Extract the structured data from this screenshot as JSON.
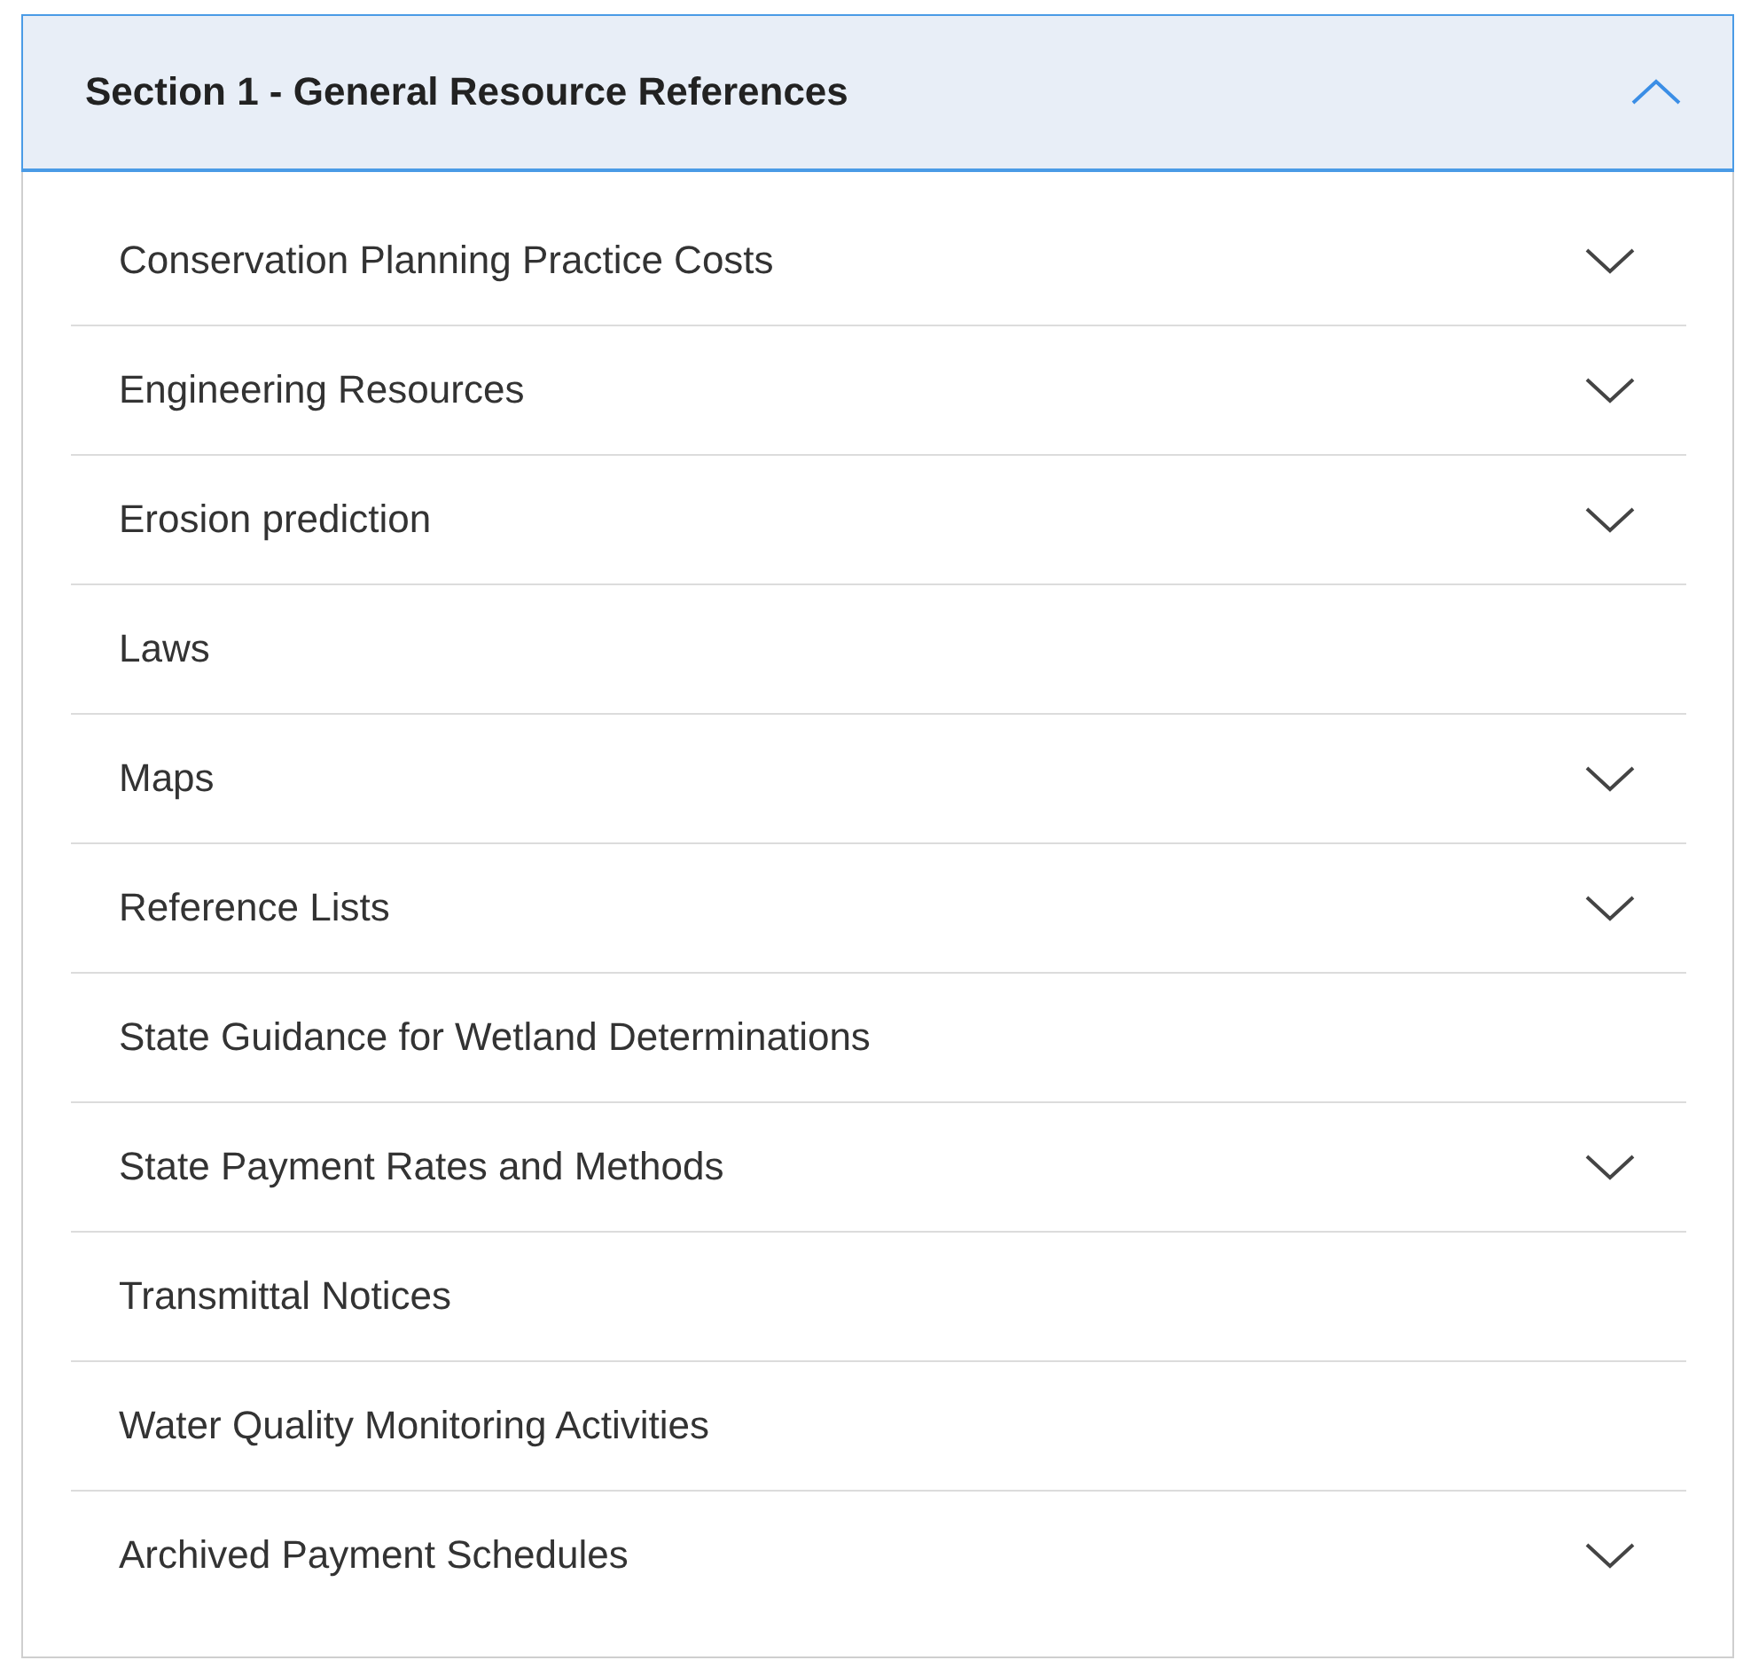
{
  "section": {
    "title": "Section 1 - General Resource References",
    "expanded": true,
    "items": [
      {
        "label": "Conservation Planning Practice Costs",
        "kind": "expandable"
      },
      {
        "label": "Engineering Resources",
        "kind": "expandable"
      },
      {
        "label": "Erosion prediction",
        "kind": "expandable"
      },
      {
        "label": "Laws",
        "kind": "link"
      },
      {
        "label": "Maps",
        "kind": "expandable"
      },
      {
        "label": "Reference Lists",
        "kind": "expandable"
      },
      {
        "label": "State Guidance for Wetland Determinations",
        "kind": "link"
      },
      {
        "label": "State Payment Rates and Methods",
        "kind": "expandable"
      },
      {
        "label": "Transmittal Notices",
        "kind": "link"
      },
      {
        "label": "Water Quality Monitoring Activities",
        "kind": "link"
      },
      {
        "label": "Archived Payment Schedules",
        "kind": "expandable"
      }
    ]
  }
}
